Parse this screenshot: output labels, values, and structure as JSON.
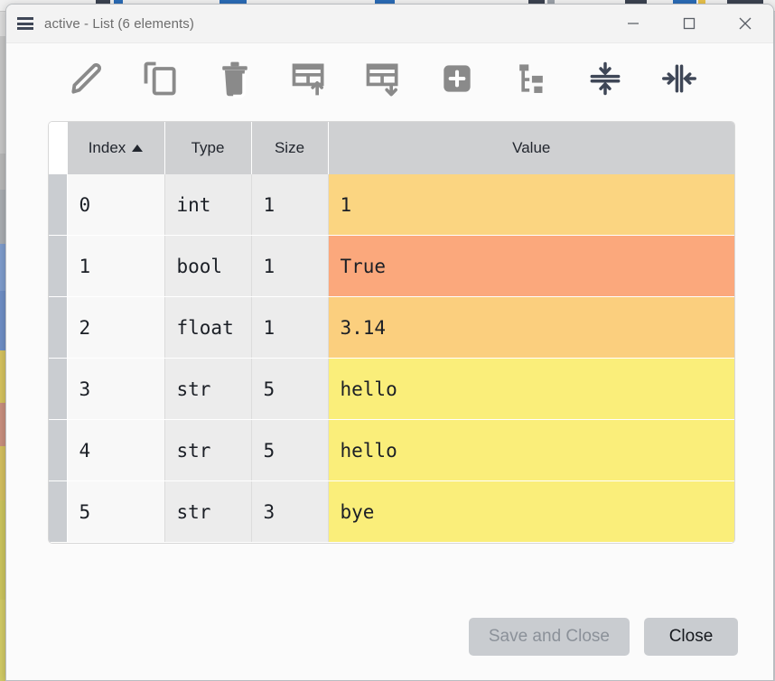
{
  "window": {
    "title": "active - List (6 elements)",
    "icon": "list-table-icon",
    "controls": {
      "minimize": "minimize-icon",
      "maximize": "maximize-icon",
      "close": "close-icon"
    }
  },
  "toolbar": {
    "buttons": [
      {
        "name": "edit-item-button",
        "icon": "pencil-icon",
        "tooltip": "Edit"
      },
      {
        "name": "duplicate-item-button",
        "icon": "copy-icon",
        "tooltip": "Duplicate"
      },
      {
        "name": "remove-item-button",
        "icon": "trash-icon",
        "tooltip": "Remove"
      },
      {
        "name": "insert-above-button",
        "icon": "insert-row-above-icon",
        "tooltip": "Insert Above"
      },
      {
        "name": "insert-below-button",
        "icon": "insert-row-below-icon",
        "tooltip": "Insert Below"
      },
      {
        "name": "add-item-button",
        "icon": "plus-square-icon",
        "tooltip": "Add"
      },
      {
        "name": "tree-view-button",
        "icon": "tree-structure-icon",
        "tooltip": "Tree View"
      },
      {
        "name": "resize-rows-button",
        "icon": "resize-rows-icon",
        "tooltip": "Resize Rows to Contents"
      },
      {
        "name": "resize-columns-button",
        "icon": "resize-columns-icon",
        "tooltip": "Resize Columns to Contents"
      }
    ]
  },
  "table": {
    "columns": [
      {
        "label": "Index",
        "sorted": "ascending"
      },
      {
        "label": "Type",
        "sorted": null
      },
      {
        "label": "Size",
        "sorted": null
      },
      {
        "label": "Value",
        "sorted": null
      }
    ],
    "rows": [
      {
        "index": "0",
        "type": "int",
        "size": "1",
        "value": "1",
        "value_color": "#fbd581"
      },
      {
        "index": "1",
        "type": "bool",
        "size": "1",
        "value": "True",
        "value_color": "#fba87c"
      },
      {
        "index": "2",
        "type": "float",
        "size": "1",
        "value": "3.14",
        "value_color": "#fbcf7e"
      },
      {
        "index": "3",
        "type": "str",
        "size": "5",
        "value": "hello",
        "value_color": "#faee7a"
      },
      {
        "index": "4",
        "type": "str",
        "size": "5",
        "value": "hello",
        "value_color": "#faee7a"
      },
      {
        "index": "5",
        "type": "str",
        "size": "3",
        "value": "bye",
        "value_color": "#faee7a"
      }
    ]
  },
  "footer": {
    "save_and_close_label": "Save and Close",
    "save_and_close_enabled": false,
    "close_label": "Close",
    "close_enabled": true
  },
  "colors": {
    "header_bg": "#cfd0d2",
    "row_header_bg": "#cacdd1",
    "index_cell_bg": "#f8f8f8",
    "type_cell_bg": "#ececec",
    "dialog_bg": "#fbfbfb",
    "titlebar_bg": "#f3f3f3",
    "button_bg": "#c9ccd0",
    "icon_gray": "#8a8a8a",
    "icon_dark": "#3f4757"
  }
}
